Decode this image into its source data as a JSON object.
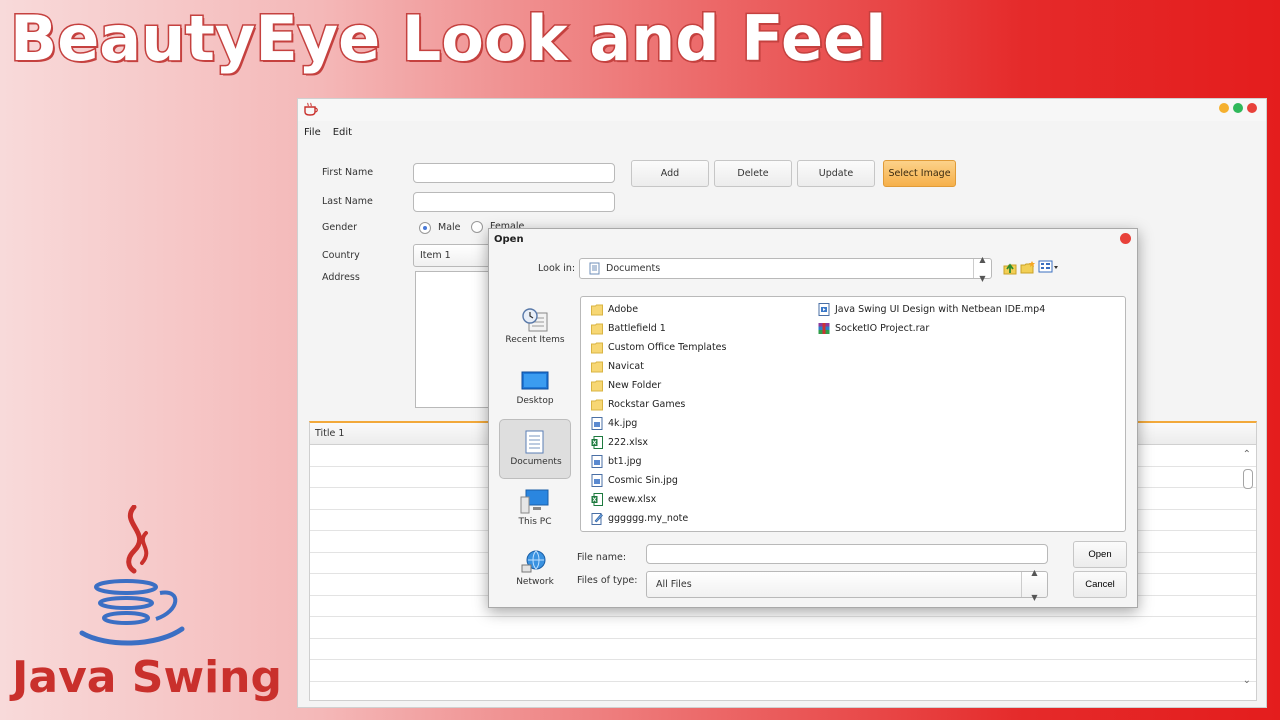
{
  "banner": {
    "title": "BeautyEye Look and Feel",
    "footer": "Java Swing"
  },
  "menu": {
    "items": [
      "File",
      "Edit"
    ]
  },
  "form": {
    "first_name_label": "First Name",
    "last_name_label": "Last Name",
    "gender_label": "Gender",
    "gender_male": "Male",
    "gender_female": "Female",
    "country_label": "Country",
    "country_value": "Item 1",
    "address_label": "Address"
  },
  "toolbar": {
    "add": "Add",
    "delete": "Delete",
    "update": "Update",
    "select_image": "Select Image"
  },
  "table": {
    "columns": [
      "Title 1"
    ]
  },
  "dialog": {
    "title": "Open",
    "look_in_label": "Look in:",
    "look_in_value": "Documents",
    "places": [
      "Recent Items",
      "Desktop",
      "Documents",
      "This PC",
      "Network"
    ],
    "files_col1": [
      {
        "name": "Adobe",
        "icon": "folder-icon"
      },
      {
        "name": "Battlefield 1",
        "icon": "folder-icon"
      },
      {
        "name": "Custom Office Templates",
        "icon": "folder-icon"
      },
      {
        "name": "Navicat",
        "icon": "folder-icon"
      },
      {
        "name": "New Folder",
        "icon": "folder-icon"
      },
      {
        "name": "Rockstar Games",
        "icon": "folder-icon"
      },
      {
        "name": "4k.jpg",
        "icon": "image-file-icon"
      },
      {
        "name": "222.xlsx",
        "icon": "excel-file-icon"
      },
      {
        "name": "bt1.jpg",
        "icon": "image-file-icon"
      },
      {
        "name": "Cosmic Sin.jpg",
        "icon": "image-file-icon"
      },
      {
        "name": "ewew.xlsx",
        "icon": "excel-file-icon"
      },
      {
        "name": "gggggg.my_note",
        "icon": "note-file-icon"
      }
    ],
    "files_col2": [
      {
        "name": "Java Swing UI Design with Netbean IDE.mp4",
        "icon": "video-file-icon"
      },
      {
        "name": "SocketIO Project.rar",
        "icon": "archive-file-icon"
      }
    ],
    "file_name_label": "File name:",
    "files_of_type_label": "Files of type:",
    "files_of_type_value": "All Files",
    "open_button": "Open",
    "cancel_button": "Cancel"
  }
}
